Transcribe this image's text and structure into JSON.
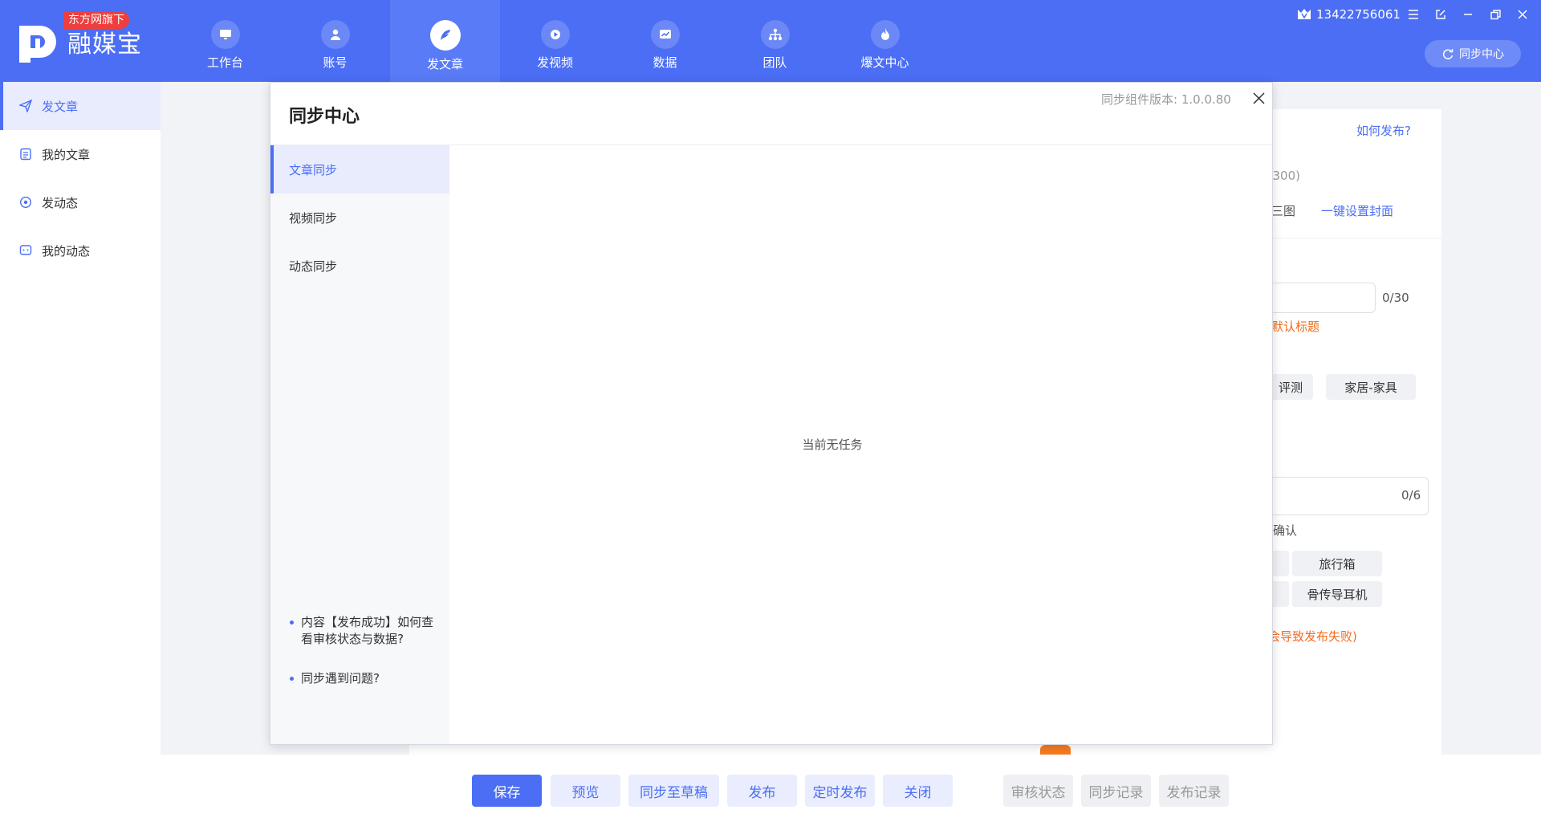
{
  "brand": {
    "tag": "东方网旗下",
    "name": "融媒宝"
  },
  "nav": [
    {
      "label": "工作台",
      "icon": "monitor-icon"
    },
    {
      "label": "账号",
      "icon": "user-icon"
    },
    {
      "label": "发文章",
      "icon": "feather-icon",
      "active": true
    },
    {
      "label": "发视频",
      "icon": "play-icon"
    },
    {
      "label": "数据",
      "icon": "chart-icon"
    },
    {
      "label": "团队",
      "icon": "org-icon"
    },
    {
      "label": "爆文中心",
      "icon": "fire-icon"
    }
  ],
  "user": {
    "phone": "13422756061"
  },
  "header": {
    "sync_center": "同步中心"
  },
  "sidebar": {
    "items": [
      {
        "label": "发文章",
        "icon": "send-icon",
        "active": true
      },
      {
        "label": "我的文章",
        "icon": "document-icon"
      },
      {
        "label": "发动态",
        "icon": "compass-icon"
      },
      {
        "label": "我的动态",
        "icon": "chat-icon"
      }
    ]
  },
  "form_bg": {
    "how_to_publish": "如何发布?",
    "cover_size_hint": "*300)",
    "three_images": "三图",
    "one_click_cover": "一键设置封面",
    "title_counter": "0/30",
    "default_title": "默认标题",
    "tag_review": "评测",
    "tag_home": "家居-家具",
    "field_counter": "0/6",
    "confirm": "确认",
    "tag_luggage": "旅行箱",
    "tag_earphone": "骨传导耳机",
    "fail_warning": "会导致发布失败)"
  },
  "actions": {
    "save": "保存",
    "preview": "预览",
    "sync_draft": "同步至草稿",
    "publish": "发布",
    "scheduled": "定时发布",
    "close": "关闭",
    "review_status": "审核状态",
    "sync_log": "同步记录",
    "publish_log": "发布记录"
  },
  "modal": {
    "title": "同步中心",
    "version": "同步组件版本: 1.0.0.80",
    "tabs": [
      "文章同步",
      "视频同步",
      "动态同步"
    ],
    "empty": "当前无任务",
    "help": [
      "内容【发布成功】如何查看审核状态与数据?",
      "同步遇到问题?"
    ]
  },
  "colors": {
    "primary": "#4b6ef5",
    "danger": "#ef3e3e",
    "warning": "#f26b1d"
  }
}
